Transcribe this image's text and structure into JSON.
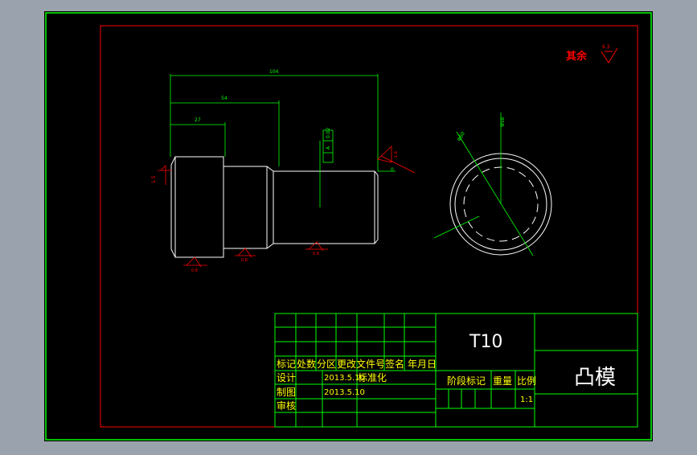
{
  "colors": {
    "background_outer": "#9aa3ad",
    "sheet": "#000000",
    "border_green": "#00ff00",
    "frame_red": "#ff0000",
    "geometry_white": "#ffffff",
    "dimension_green": "#00ff00",
    "annotation_red": "#ff0000",
    "text_white": "#ffffff",
    "text_yellow": "#ffff00",
    "text_cyan": "#00ffff"
  },
  "roughness_note": {
    "label": "其余",
    "value": "6.3"
  },
  "dimensions": {
    "overall_length": "104",
    "length_54": "54",
    "length_27": "27",
    "gap": "0",
    "chamfer": "1.5",
    "circle_dia": "Φ60",
    "circle_dia2": "Φ58"
  },
  "tolerance_frame": [
    "0.02",
    "A"
  ],
  "roughness_marks": [
    "1.6",
    "0.8",
    "0.8",
    "0.8"
  ],
  "title_block": {
    "material": "T10",
    "part_name": "凸模",
    "header": [
      "标记",
      "处数",
      "分区",
      "更改文件号",
      "签名",
      "年月日"
    ],
    "rows": [
      {
        "role": "设计",
        "date": "2013.5.10",
        "note": "标准化"
      },
      {
        "role": "制图",
        "date": "2013.5.10",
        "note": ""
      },
      {
        "role": "审核",
        "date": "",
        "note": ""
      }
    ],
    "stage_header": [
      "阶段标记",
      "重量",
      "比例"
    ],
    "scale": "1:1"
  }
}
